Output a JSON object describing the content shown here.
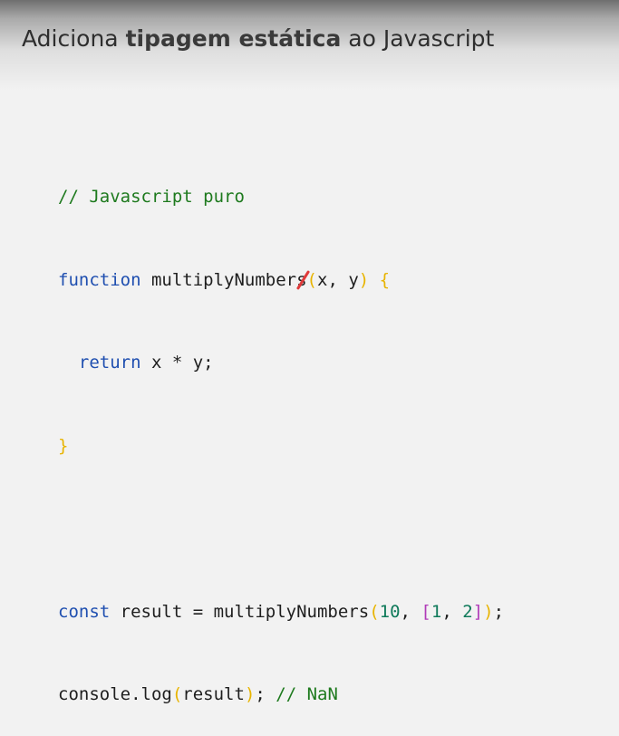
{
  "slide": {
    "title_part1": "Adiciona ",
    "title_bold": "tipagem estática",
    "title_part2": " ao Javascript"
  },
  "code": {
    "line1_comment": "// Javascript puro",
    "line2_keyword": "function",
    "line2_name": " multiplyNumbers",
    "line2_paren_open": "(",
    "line2_params": "x, y",
    "line2_paren_close": ")",
    "line2_brace_open": " {",
    "line3_indent": "  ",
    "line3_keyword": "return",
    "line3_expr": " x * y;",
    "line4_brace_close": "}",
    "line6_keyword": "const",
    "line6_text": " result = multiplyNumbers",
    "line6_paren_open": "(",
    "line6_num1": "10",
    "line6_comma": ", ",
    "line6_bracket_open": "[",
    "line6_num2": "1",
    "line6_comma2": ", ",
    "line6_num3": "2",
    "line6_bracket_close": "]",
    "line6_paren_close": ")",
    "line6_end": ";",
    "line7_obj": "console.log",
    "line7_paren_open": "(",
    "line7_arg": "result",
    "line7_paren_close": ")",
    "line7_semicolon": "; ",
    "line7_comment": "// NaN"
  },
  "colors": {
    "comment": "#1e7a1e",
    "keyword": "#1f4fb0",
    "brace": "#e8b400",
    "bracket": "#b03ab8",
    "number": "#0f7a5a",
    "annotation": "#e03a3a"
  }
}
